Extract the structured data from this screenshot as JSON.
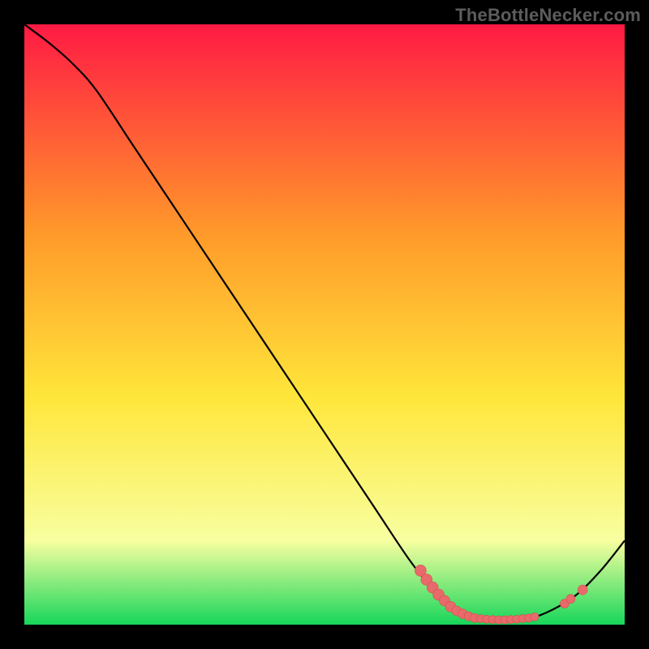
{
  "watermark": "TheBottleNecker.com",
  "colors": {
    "gradient_top": "#ff1a44",
    "gradient_mid_orange": "#ff9a2a",
    "gradient_mid_yellow": "#ffe63a",
    "gradient_pale_yellow": "#f8ffa0",
    "gradient_green": "#17d65a",
    "curve_stroke": "#000000",
    "marker_fill": "#e86a6a",
    "marker_stroke": "#d64f4f",
    "frame_bg": "#000000"
  },
  "chart_data": {
    "type": "line",
    "title": "",
    "xlabel": "",
    "ylabel": "",
    "xlim": [
      0,
      100
    ],
    "ylim": [
      0,
      100
    ],
    "grid": false,
    "curve": [
      {
        "x": 0,
        "y": 100
      },
      {
        "x": 4,
        "y": 97
      },
      {
        "x": 8,
        "y": 93.5
      },
      {
        "x": 12,
        "y": 89
      },
      {
        "x": 18,
        "y": 80
      },
      {
        "x": 26,
        "y": 68
      },
      {
        "x": 34,
        "y": 56
      },
      {
        "x": 42,
        "y": 44
      },
      {
        "x": 50,
        "y": 32
      },
      {
        "x": 58,
        "y": 20
      },
      {
        "x": 64,
        "y": 11
      },
      {
        "x": 68,
        "y": 6
      },
      {
        "x": 72,
        "y": 2.5
      },
      {
        "x": 76,
        "y": 1
      },
      {
        "x": 80,
        "y": 0.8
      },
      {
        "x": 84,
        "y": 1
      },
      {
        "x": 88,
        "y": 2.5
      },
      {
        "x": 92,
        "y": 5
      },
      {
        "x": 96,
        "y": 9
      },
      {
        "x": 100,
        "y": 14
      }
    ],
    "markers": [
      {
        "x": 66,
        "y": 9,
        "r": 1.4
      },
      {
        "x": 67,
        "y": 7.5,
        "r": 1.4
      },
      {
        "x": 68,
        "y": 6.2,
        "r": 1.4
      },
      {
        "x": 69,
        "y": 5,
        "r": 1.4
      },
      {
        "x": 70,
        "y": 4,
        "r": 1.3
      },
      {
        "x": 71,
        "y": 3,
        "r": 1.3
      },
      {
        "x": 72,
        "y": 2.3,
        "r": 1.2
      },
      {
        "x": 73,
        "y": 1.8,
        "r": 1.2
      },
      {
        "x": 74,
        "y": 1.4,
        "r": 1.1
      },
      {
        "x": 75,
        "y": 1.1,
        "r": 1.1
      },
      {
        "x": 76,
        "y": 1.0,
        "r": 1.0
      },
      {
        "x": 77,
        "y": 0.9,
        "r": 1.0
      },
      {
        "x": 78,
        "y": 0.85,
        "r": 1.0
      },
      {
        "x": 79,
        "y": 0.8,
        "r": 1.0
      },
      {
        "x": 80,
        "y": 0.8,
        "r": 1.0
      },
      {
        "x": 81,
        "y": 0.85,
        "r": 1.0
      },
      {
        "x": 82,
        "y": 0.9,
        "r": 1.0
      },
      {
        "x": 83,
        "y": 1.0,
        "r": 1.0
      },
      {
        "x": 84,
        "y": 1.1,
        "r": 1.0
      },
      {
        "x": 85,
        "y": 1.3,
        "r": 1.0
      },
      {
        "x": 90,
        "y": 3.5,
        "r": 1.1
      },
      {
        "x": 91,
        "y": 4.3,
        "r": 1.1
      },
      {
        "x": 93,
        "y": 5.8,
        "r": 1.2
      }
    ]
  }
}
